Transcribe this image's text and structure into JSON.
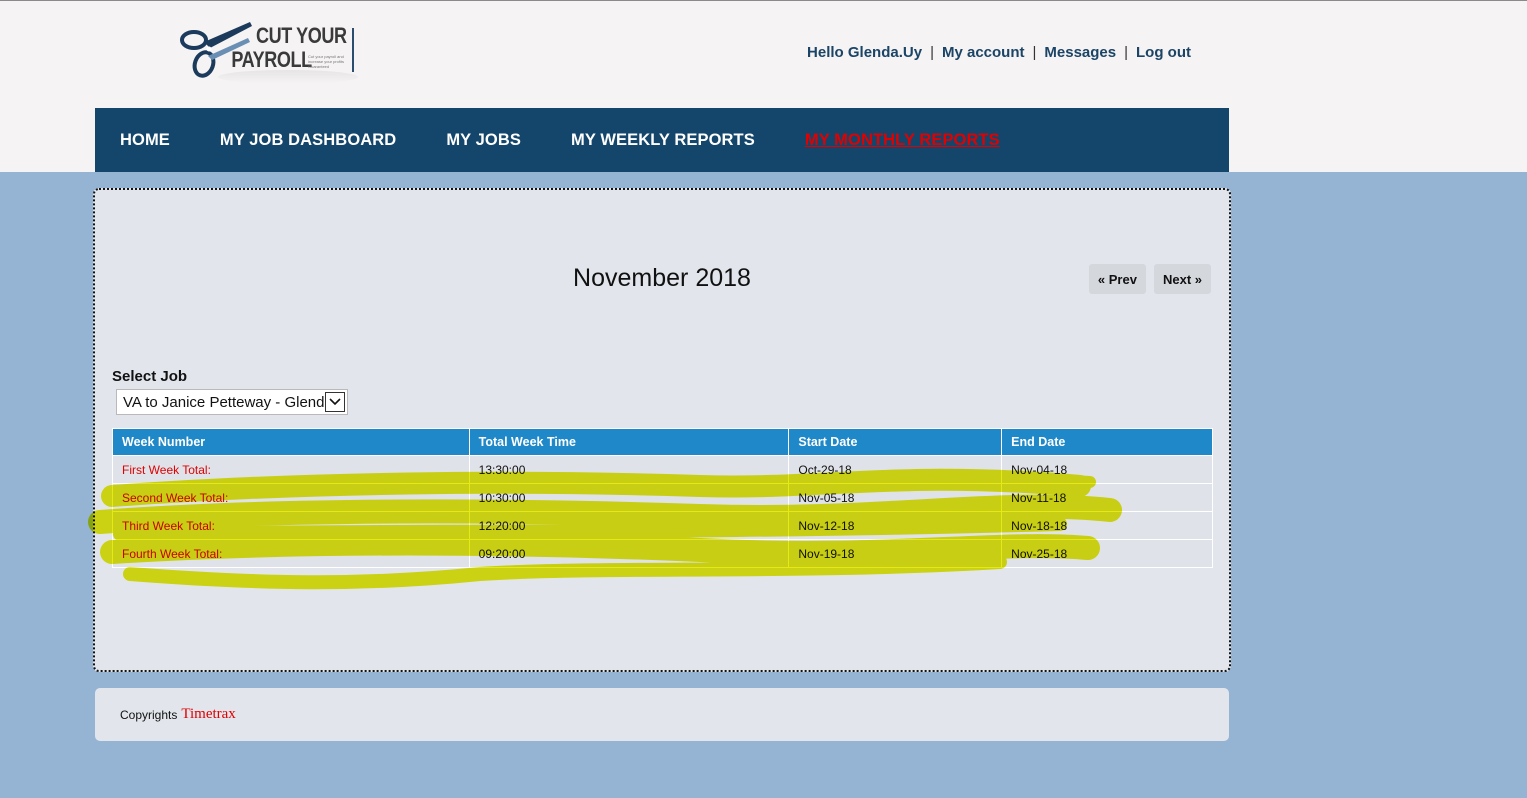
{
  "logo": {
    "line1": "CUT YOUR",
    "line2": "PAYROLL",
    "tagline": "Cut your payroll and increase your profits Guaranteed",
    "icon": "scissors-icon"
  },
  "top_links": {
    "greeting": "Hello Glenda.Uy",
    "my_account": "My account",
    "messages": "Messages",
    "logout": "Log out"
  },
  "nav": {
    "home": "HOME",
    "job_dashboard": "MY JOB DASHBOARD",
    "jobs": "MY JOBS",
    "weekly_reports": "MY WEEKLY REPORTS",
    "monthly_reports": "MY MONTHLY REPORTS"
  },
  "report": {
    "month_title": "November 2018",
    "prev_label": "« Prev",
    "next_label": "Next »",
    "select_label": "Select Job",
    "selected_job": "VA to Janice Petteway - Glenda"
  },
  "table": {
    "headers": [
      "Week Number",
      "Total Week Time",
      "Start Date",
      "End Date"
    ],
    "rows": [
      [
        "First Week Total:",
        "13:30:00",
        "Oct-29-18",
        "Nov-04-18"
      ],
      [
        "Second Week Total:",
        "10:30:00",
        "Nov-05-18",
        "Nov-11-18"
      ],
      [
        "Third Week Total:",
        "12:20:00",
        "Nov-12-18",
        "Nov-18-18"
      ],
      [
        "Fourth Week Total:",
        "09:20:00",
        "Nov-19-18",
        "Nov-25-18"
      ]
    ]
  },
  "footer": {
    "copyright": "Copyrights",
    "brand": "Timetrax"
  },
  "colors": {
    "nav_bg": "#14466c",
    "active_nav": "#e00000",
    "table_header": "#1e88c9",
    "page_bg": "#95b3d3",
    "highlight": "#e0e600"
  }
}
